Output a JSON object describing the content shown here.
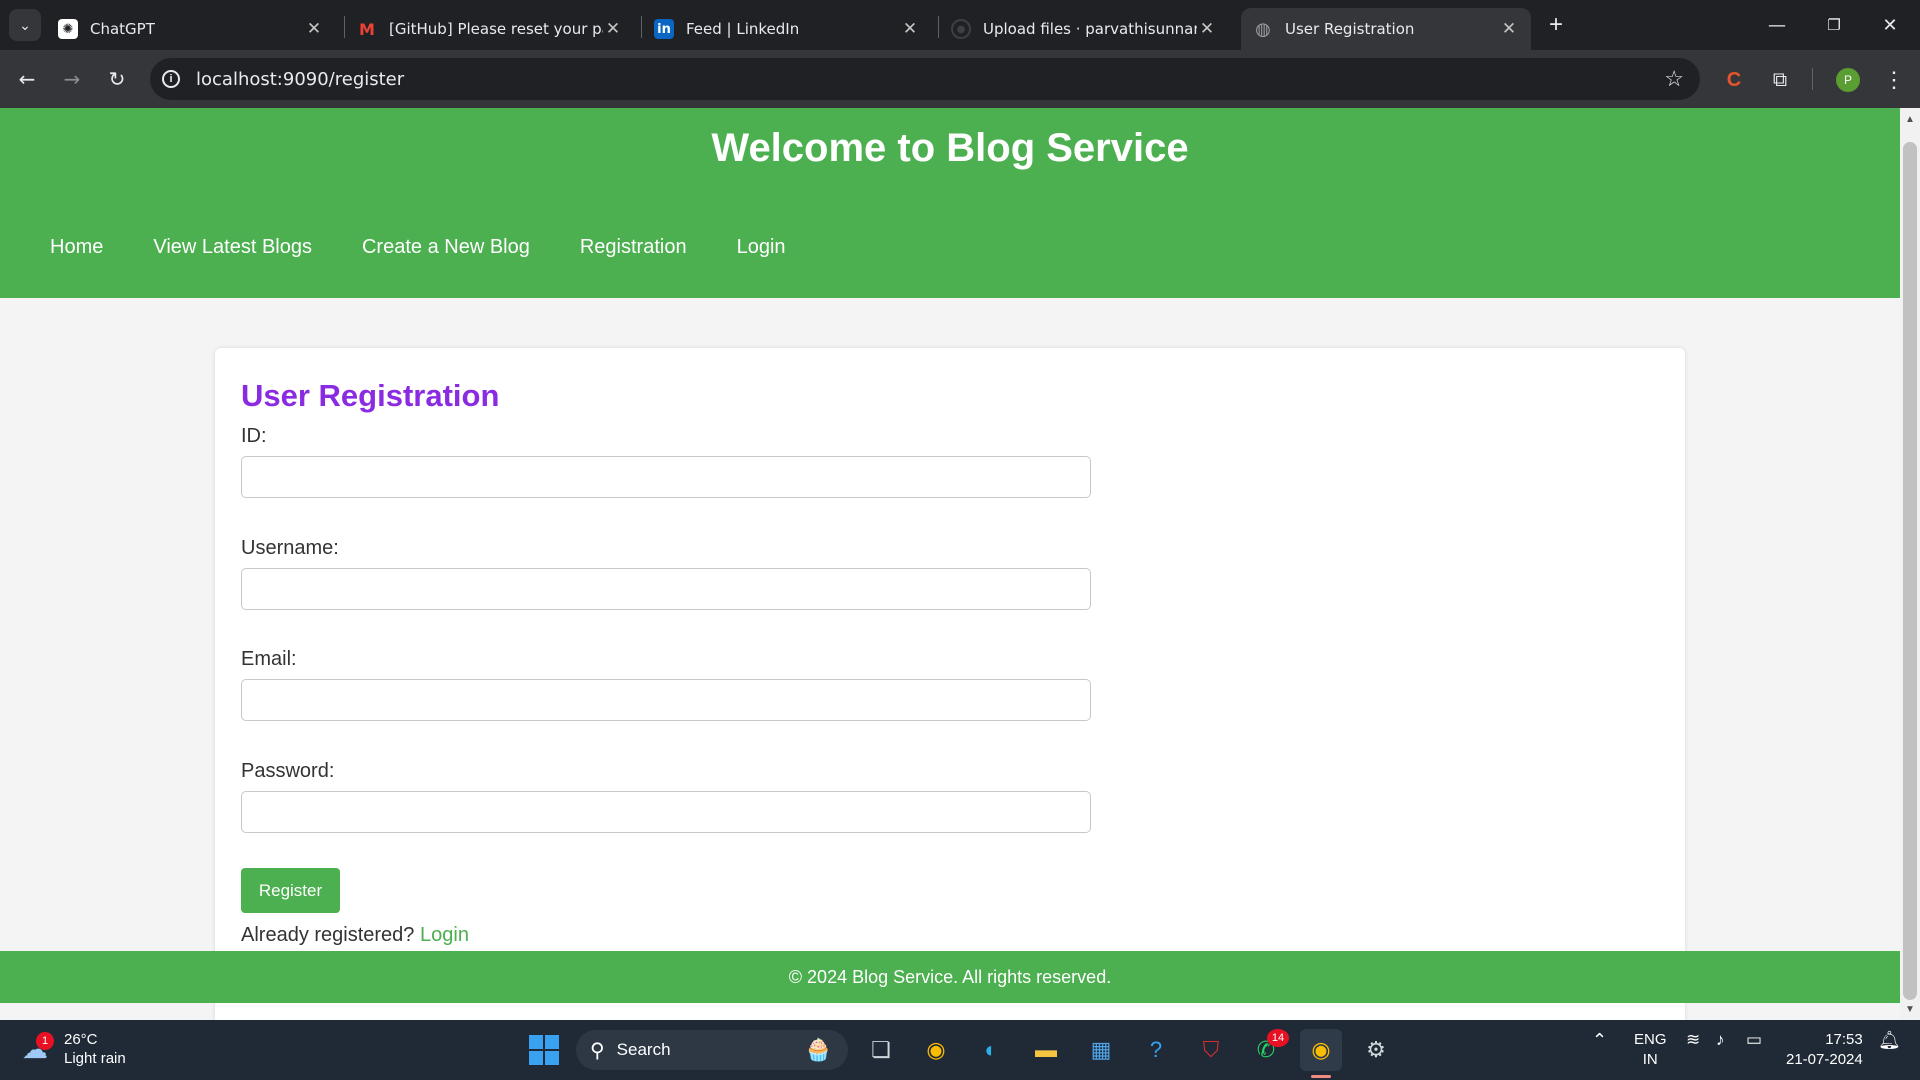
{
  "browser": {
    "tabs": [
      {
        "title": "ChatGPT",
        "icon": "chatgpt-icon",
        "active": false
      },
      {
        "title": "[GitHub] Please reset your pass",
        "icon": "gmail-icon",
        "active": false
      },
      {
        "title": "Feed | LinkedIn",
        "icon": "linkedin-icon",
        "active": false
      },
      {
        "title": "Upload files · parvathisunnam/J",
        "icon": "github-icon",
        "active": false
      },
      {
        "title": "User Registration",
        "icon": "globe-icon",
        "active": true
      }
    ],
    "url": "localhost:9090/register",
    "profile_initial": "P"
  },
  "page": {
    "header": {
      "title": "Welcome to Blog Service"
    },
    "nav": [
      "Home",
      "View Latest Blogs",
      "Create a New Blog",
      "Registration",
      "Login"
    ],
    "form": {
      "title": "User Registration",
      "fields": [
        {
          "label": "ID:",
          "value": ""
        },
        {
          "label": "Username:",
          "value": ""
        },
        {
          "label": "Email:",
          "value": ""
        },
        {
          "label": "Password:",
          "value": ""
        }
      ],
      "submit_label": "Register",
      "already_text": "Already registered?",
      "login_link": "Login"
    },
    "footer": "© 2024 Blog Service. All rights reserved.",
    "colors": {
      "accent_green": "#4caf50",
      "title_purple": "#8a2be2"
    }
  },
  "taskbar": {
    "weather": {
      "temp": "26°C",
      "desc": "Light rain",
      "badge": "1"
    },
    "search_label": "Search",
    "whatsapp_badge": "14",
    "lang": "ENG",
    "region": "IN",
    "time": "17:53",
    "date": "21-07-2024"
  }
}
